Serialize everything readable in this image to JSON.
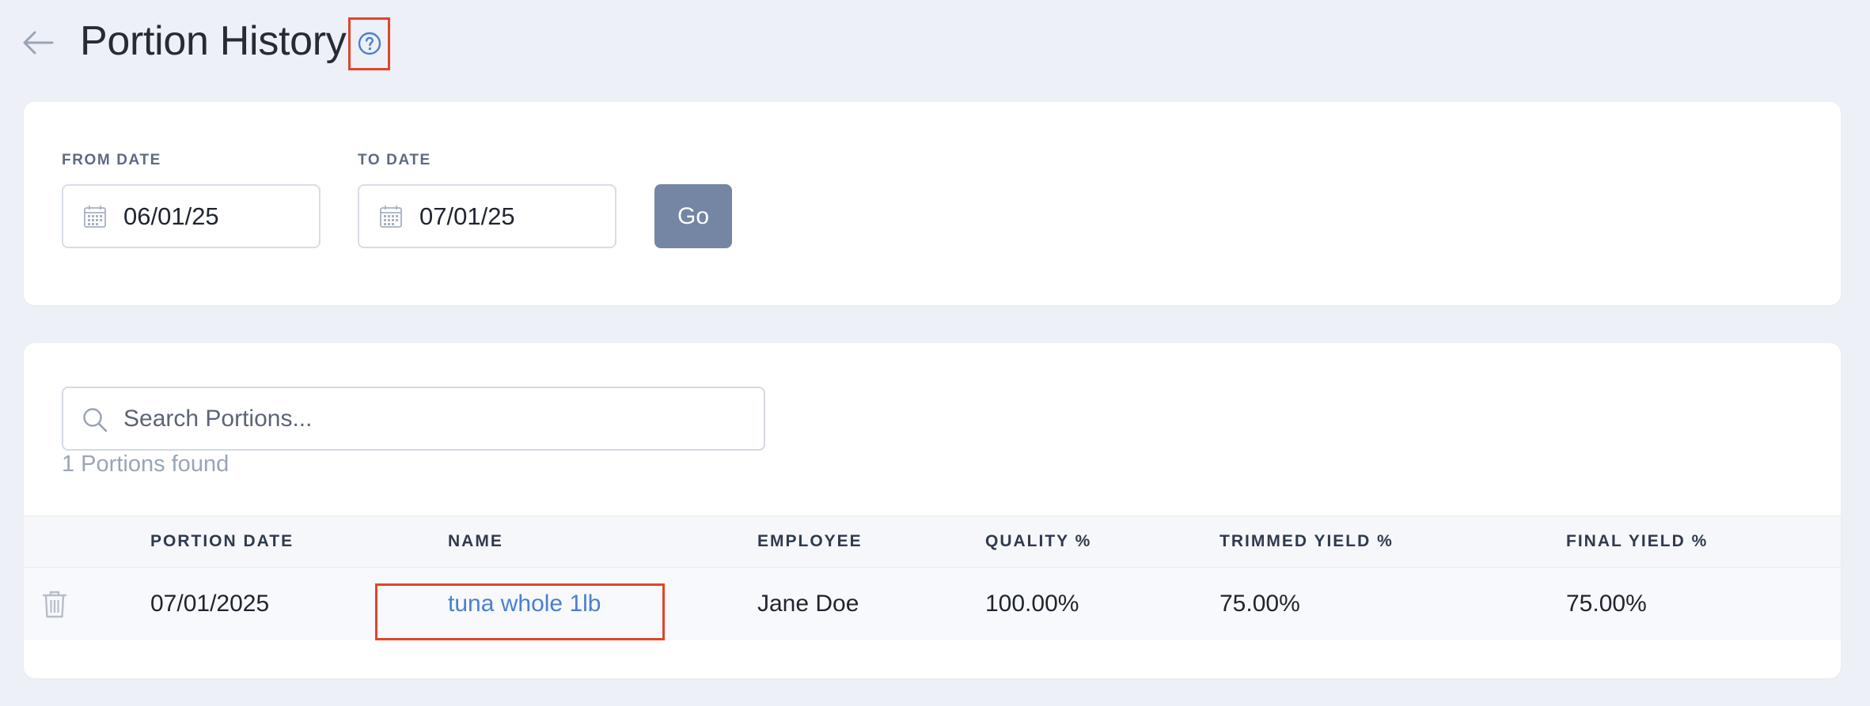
{
  "header": {
    "title": "Portion History"
  },
  "filters": {
    "from_label": "FROM DATE",
    "from_value": "06/01/25",
    "to_label": "TO DATE",
    "to_value": "07/01/25",
    "go_label": "Go"
  },
  "search": {
    "placeholder": "Search Portions...",
    "results_count": "1 Portions found"
  },
  "table": {
    "columns": [
      "PORTION DATE",
      "NAME",
      "EMPLOYEE",
      "QUALITY %",
      "TRIMMED YIELD %",
      "FINAL YIELD %"
    ],
    "rows": [
      {
        "date": "07/01/2025",
        "name": "tuna whole 1lb",
        "employee": "Jane Doe",
        "quality": "100.00%",
        "trimmed_yield": "75.00%",
        "final_yield": "75.00%"
      }
    ]
  },
  "colors": {
    "background": "#edf0f7",
    "accent_link": "#4a7fcf",
    "go_button": "#7486a3",
    "highlight_box": "#e0452b"
  },
  "icons": [
    "back-arrow-icon",
    "help-icon",
    "calendar-icon",
    "search-icon",
    "trash-icon"
  ]
}
